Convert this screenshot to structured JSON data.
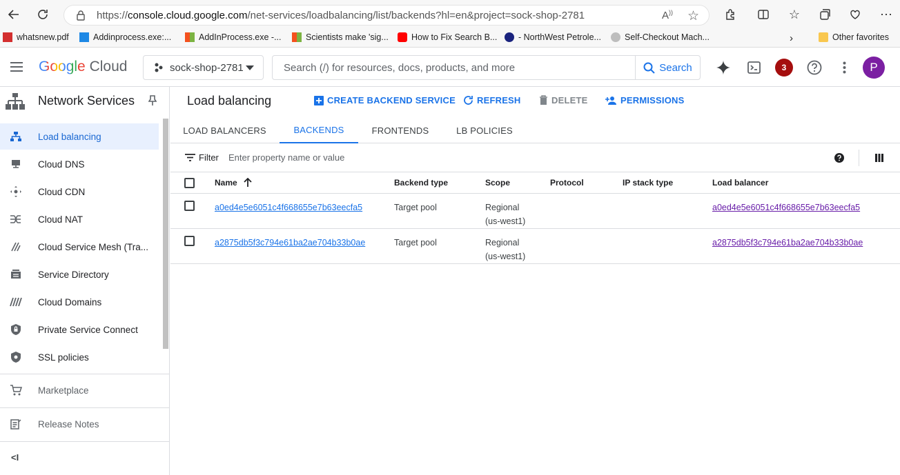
{
  "browser": {
    "url_host": "console.cloud.google.com",
    "url_prefix": "https://",
    "url_path": "/net-services/loadbalancing/list/backends?hl=en&project=sock-shop-2781",
    "bookmarks": [
      {
        "label": "whatsnew.pdf",
        "color": "#d32f2f"
      },
      {
        "label": "Addinprocess.exe:...",
        "color": "#1e88e5"
      },
      {
        "label": "AddInProcess.exe -...",
        "color": "#f4511e"
      },
      {
        "label": "Scientists make 'sig...",
        "color": "#f4511e"
      },
      {
        "label": "How to Fix Search B...",
        "color": "#ff0000"
      },
      {
        "label": "- NorthWest Petrole...",
        "color": "#1a237e"
      },
      {
        "label": "Self-Checkout Mach...",
        "color": "#9e9e9e"
      }
    ],
    "other_favorites": "Other favorites"
  },
  "header": {
    "logo_google": "Google",
    "logo_cloud": "Cloud",
    "project": "sock-shop-2781",
    "search_placeholder": "Search (/) for resources, docs, products, and more",
    "search_button": "Search",
    "notifications_count": "3",
    "avatar_letter": "P"
  },
  "sidebar": {
    "title": "Network Services",
    "items": [
      {
        "label": "Load balancing",
        "icon": "load-balancing-icon",
        "active": true
      },
      {
        "label": "Cloud DNS",
        "icon": "dns-icon"
      },
      {
        "label": "Cloud CDN",
        "icon": "cdn-icon"
      },
      {
        "label": "Cloud NAT",
        "icon": "nat-icon"
      },
      {
        "label": "Cloud Service Mesh (Tra...",
        "icon": "service-mesh-icon"
      },
      {
        "label": "Service Directory",
        "icon": "service-directory-icon"
      },
      {
        "label": "Cloud Domains",
        "icon": "domains-icon"
      },
      {
        "label": "Private Service Connect",
        "icon": "private-service-connect-icon"
      },
      {
        "label": "SSL policies",
        "icon": "ssl-policies-icon"
      }
    ],
    "marketplace": "Marketplace",
    "release_notes": "Release Notes",
    "collapse": "<I"
  },
  "main": {
    "title": "Load balancing",
    "actions": {
      "create": "CREATE BACKEND SERVICE",
      "refresh": "REFRESH",
      "delete": "DELETE",
      "permissions": "PERMISSIONS"
    },
    "tabs": [
      "LOAD BALANCERS",
      "BACKENDS",
      "FRONTENDS",
      "LB POLICIES"
    ],
    "active_tab": "BACKENDS",
    "filter_label": "Filter",
    "filter_placeholder": "Enter property name or value",
    "columns": [
      "Name",
      "Backend type",
      "Scope",
      "Protocol",
      "IP stack type",
      "Load balancer"
    ],
    "rows": [
      {
        "name": "a0ed4e5e6051c4f668655e7b63eecfa5",
        "backend_type": "Target pool",
        "scope_1": "Regional",
        "scope_2": "(us-west1)",
        "protocol": "",
        "ip_stack": "",
        "load_balancer": "a0ed4e5e6051c4f668655e7b63eecfa5"
      },
      {
        "name": "a2875db5f3c794e61ba2ae704b33b0ae",
        "backend_type": "Target pool",
        "scope_1": "Regional",
        "scope_2": "(us-west1)",
        "protocol": "",
        "ip_stack": "",
        "load_balancer": "a2875db5f3c794e61ba2ae704b33b0ae"
      }
    ]
  },
  "colors": {
    "accent": "#1a73e8",
    "active_bg": "#e8f0fe",
    "badge": "#c5221f",
    "avatar": "#7b1fa2"
  }
}
